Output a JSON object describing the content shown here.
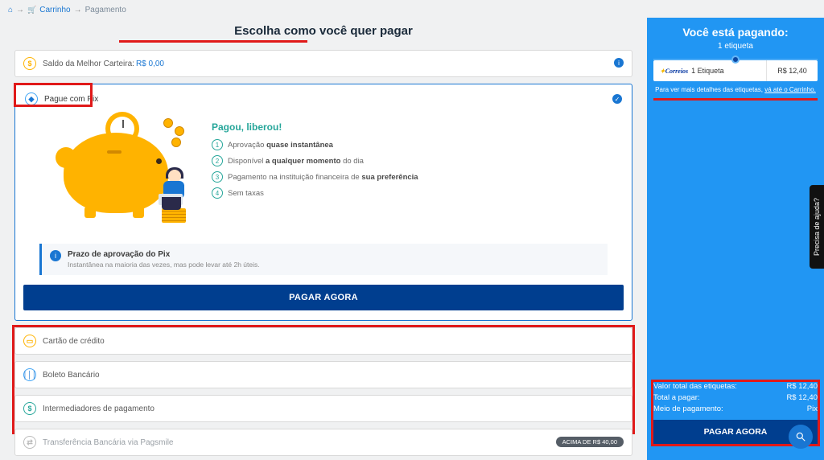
{
  "breadcrumb": {
    "home_icon": "⌂",
    "cart": "Carrinho",
    "current": "Pagamento"
  },
  "headline": "Escolha como você quer pagar",
  "wallet": {
    "label": "Saldo da Melhor Carteira:",
    "value": "R$ 0,00"
  },
  "pix": {
    "title": "Pague com Pix",
    "benefits_title": "Pagou, liberou!",
    "b1a": "Aprovação ",
    "b1b": "quase instantânea",
    "b2a": "Disponível ",
    "b2b": "a qualquer momento ",
    "b2c": "do dia",
    "b3a": "Pagamento na instituição financeira de ",
    "b3b": "sua preferência",
    "b4": "Sem taxas",
    "notice_title": "Prazo de aprovação do Pix",
    "notice_sub": "Instantânea na maioria das vezes, mas pode levar até 2h úteis.",
    "cta": "PAGAR AGORA"
  },
  "methods": {
    "credit": "Cartão de crédito",
    "boleto": "Boleto Bancário",
    "intermediaries": "Intermediadores de pagamento",
    "transfer": "Transferência Bancária via Pagsmile",
    "transfer_badge": "ACIMA DE R$ 40,00"
  },
  "sidebar": {
    "title": "Você está pagando:",
    "count": "1 etiqueta",
    "row_label": "1 Etiqueta",
    "row_value": "R$ 12,40",
    "note_a": "Para ver mais detalhes das etiquetas, ",
    "note_link": "vá até o Carrinho.",
    "total_labels_k": "Valor total das etiquetas:",
    "total_labels_v": "R$ 12,40",
    "total_pay_k": "Total a pagar:",
    "total_pay_v": "R$ 12,40",
    "method_k": "Meio de pagamento:",
    "method_v": "Pix",
    "cta": "PAGAR AGORA"
  },
  "help_tab": "Precisa de ajuda?"
}
